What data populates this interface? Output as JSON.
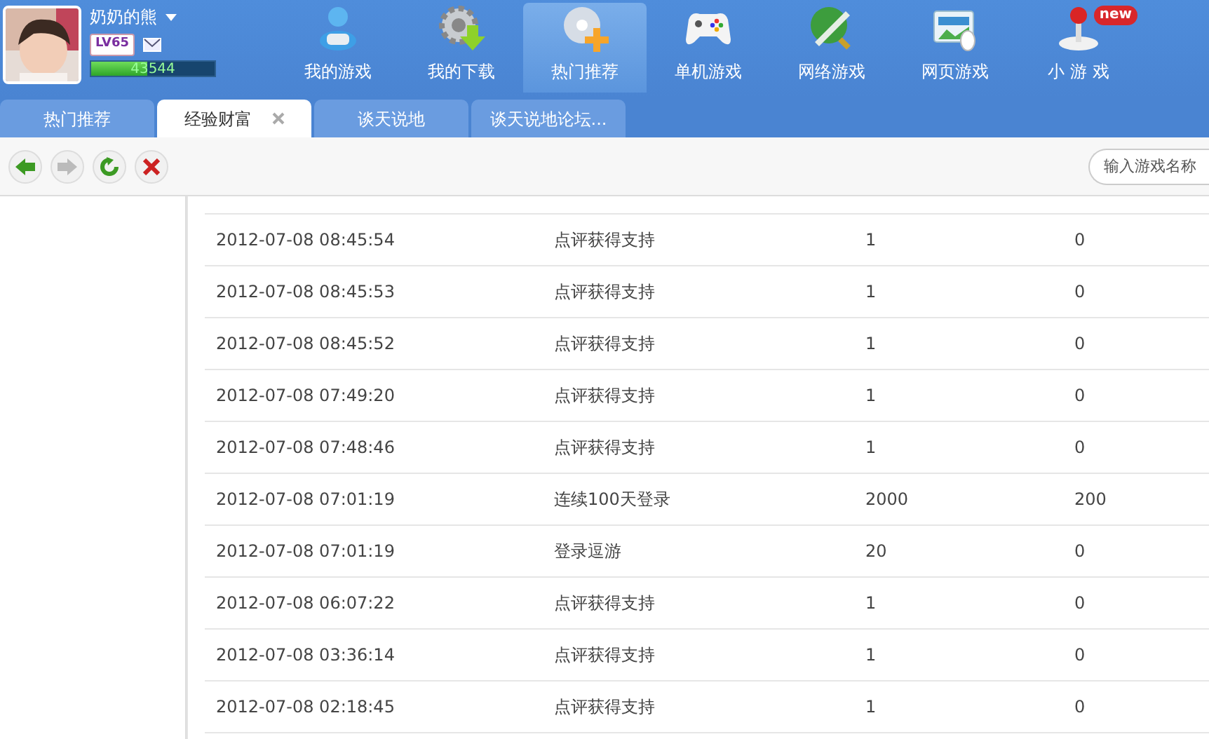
{
  "user": {
    "name": "奶奶的熊",
    "level_badge": "LV65",
    "exp": "43544",
    "level": 0.45
  },
  "nav": [
    {
      "label": "我的游戏",
      "selected": false
    },
    {
      "label": "我的下载",
      "selected": false
    },
    {
      "label": "热门推荐",
      "selected": true
    },
    {
      "label": "单机游戏",
      "selected": false
    },
    {
      "label": "网络游戏",
      "selected": false
    },
    {
      "label": "网页游戏",
      "selected": false
    },
    {
      "label": "小 游 戏",
      "selected": false,
      "badge": "new"
    }
  ],
  "tabs": [
    {
      "label": "热门推荐",
      "selected": false
    },
    {
      "label": "经验财富",
      "selected": true
    },
    {
      "label": "谈天说地",
      "selected": false
    },
    {
      "label": "谈天说地论坛...",
      "selected": false
    }
  ],
  "toolbar": [
    {
      "kind": "back",
      "disabled": false
    },
    {
      "kind": "forward",
      "disabled": true
    },
    {
      "kind": "refresh",
      "disabled": false
    },
    {
      "kind": "stop",
      "disabled": false
    }
  ],
  "search": {
    "placeholder": "输入游戏名称"
  },
  "table": {
    "rows": [
      [
        "2012-07-08 08:45:54",
        "点评获得支持",
        "1",
        "0"
      ],
      [
        "2012-07-08 08:45:53",
        "点评获得支持",
        "1",
        "0"
      ],
      [
        "2012-07-08 08:45:52",
        "点评获得支持",
        "1",
        "0"
      ],
      [
        "2012-07-08 07:49:20",
        "点评获得支持",
        "1",
        "0"
      ],
      [
        "2012-07-08 07:48:46",
        "点评获得支持",
        "1",
        "0"
      ],
      [
        "2012-07-08 07:01:19",
        "连续100天登录",
        "2000",
        "200"
      ],
      [
        "2012-07-08 07:01:19",
        "登录逗游",
        "20",
        "0"
      ],
      [
        "2012-07-08 06:07:22",
        "点评获得支持",
        "1",
        "0"
      ],
      [
        "2012-07-08 03:36:14",
        "点评获得支持",
        "1",
        "0"
      ],
      [
        "2012-07-08 02:18:45",
        "点评获得支持",
        "1",
        "0"
      ]
    ]
  }
}
